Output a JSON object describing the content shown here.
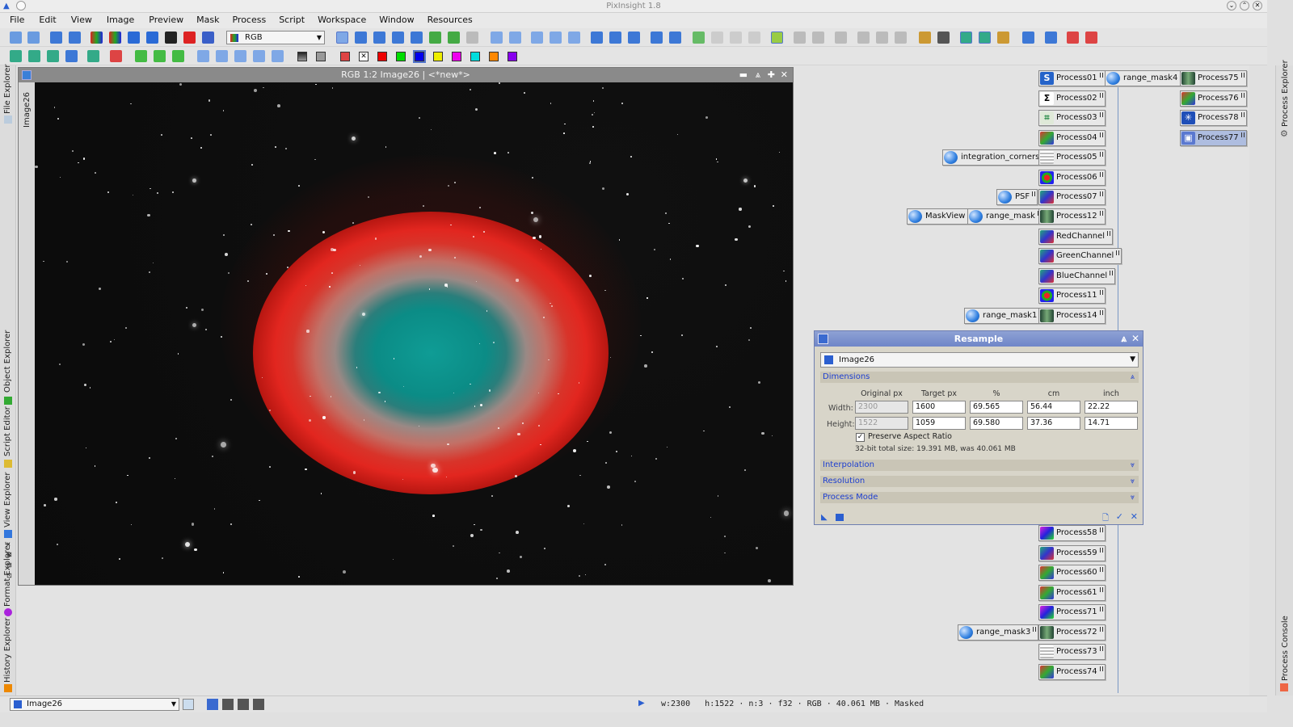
{
  "app": {
    "title": "PixInsight 1.8"
  },
  "menu": [
    "File",
    "Edit",
    "View",
    "Image",
    "Preview",
    "Mask",
    "Process",
    "Script",
    "Workspace",
    "Window",
    "Resources"
  ],
  "toolbar": {
    "channel_select": "RGB"
  },
  "left_dock": [
    "File Explorer",
    "Object Explorer",
    "Script Editor",
    "View Explorer",
    "Format Explorer",
    "History Explorer"
  ],
  "right_dock": [
    "Process Explorer",
    "Process Console"
  ],
  "image_window": {
    "title": "RGB 1:2 Image26 | <*new*>",
    "side_tab": "Image26"
  },
  "process_icons": [
    {
      "label": "Process01",
      "icon": "S"
    },
    {
      "label": "range_mask4",
      "icon": "instance"
    },
    {
      "label": "Process75",
      "icon": "curves"
    },
    {
      "label": "Process02",
      "icon": "Σ"
    },
    {
      "label": "Process76",
      "icon": "bars"
    },
    {
      "label": "Process03",
      "icon": "crop"
    },
    {
      "label": "Process78",
      "icon": "star"
    },
    {
      "label": "Process04",
      "icon": "bars"
    },
    {
      "label": "Process77",
      "icon": "window"
    },
    {
      "label": "integration_corners",
      "icon": "instance"
    },
    {
      "label": "Process05",
      "icon": "grid"
    },
    {
      "label": "Process06",
      "icon": "rgb"
    },
    {
      "label": "PSF",
      "icon": "instance"
    },
    {
      "label": "Process07",
      "icon": "curve"
    },
    {
      "label": "MaskView",
      "icon": "instance"
    },
    {
      "label": "range_mask",
      "icon": "instance"
    },
    {
      "label": "Process12",
      "icon": "curves"
    },
    {
      "label": "RedChannel",
      "icon": "curve"
    },
    {
      "label": "GreenChannel",
      "icon": "curve"
    },
    {
      "label": "BlueChannel",
      "icon": "curve"
    },
    {
      "label": "Process11",
      "icon": "rgb"
    },
    {
      "label": "range_mask1",
      "icon": "instance"
    },
    {
      "label": "Process14",
      "icon": "curves"
    },
    {
      "label": "Process58",
      "icon": "color"
    },
    {
      "label": "Process59",
      "icon": "curve"
    },
    {
      "label": "Process60",
      "icon": "bars"
    },
    {
      "label": "Process61",
      "icon": "bars"
    },
    {
      "label": "Process71",
      "icon": "color"
    },
    {
      "label": "range_mask3",
      "icon": "instance"
    },
    {
      "label": "Process72",
      "icon": "curves"
    },
    {
      "label": "Process73",
      "icon": "grid"
    },
    {
      "label": "Process74",
      "icon": "bars"
    }
  ],
  "resample": {
    "title": "Resample",
    "target": "Image26",
    "sections": {
      "dimensions": "Dimensions",
      "interpolation": "Interpolation",
      "resolution": "Resolution",
      "process_mode": "Process Mode"
    },
    "columns": [
      "Original px",
      "Target px",
      "%",
      "cm",
      "inch"
    ],
    "width": {
      "label": "Width:",
      "original": "2300",
      "target": "1600",
      "percent": "69.565",
      "cm": "56.44",
      "inch": "22.22"
    },
    "height": {
      "label": "Height:",
      "original": "1522",
      "target": "1059",
      "percent": "69.580",
      "cm": "37.36",
      "inch": "14.71"
    },
    "preserve_aspect": "Preserve Aspect Ratio",
    "size_info": "32-bit total size: 19.391 MB, was 40.061 MB"
  },
  "statusbar": {
    "view": "Image26",
    "info": "w:2300   h:1522 · n:3 · f32 · RGB · 40.061 MB · Masked"
  },
  "colors": {
    "accent": "#6f86c8",
    "section": "#1e3fd0",
    "icon_blue": "#2f7fe0"
  }
}
